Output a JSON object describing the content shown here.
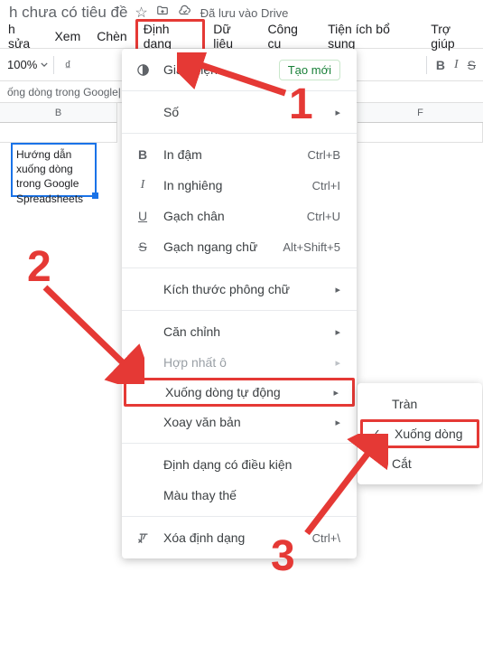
{
  "titlebar": {
    "title": "h chưa có tiêu đề",
    "saved": "Đã lưu vào Drive"
  },
  "menubar": {
    "items": [
      {
        "label": "h sửa"
      },
      {
        "label": "Xem"
      },
      {
        "label": "Chèn"
      },
      {
        "label": "Định dạng"
      },
      {
        "label": "Dữ liệu"
      },
      {
        "label": "Công cụ"
      },
      {
        "label": "Tiện ích bổ sung"
      },
      {
        "label": "Trợ giúp"
      }
    ]
  },
  "toolbar": {
    "zoom": "100%",
    "bold": "B",
    "italic": "I",
    "strike": "S"
  },
  "fxbar": {
    "text": "ống dòng trong Google|"
  },
  "columns": {
    "b": "B",
    "f": "F"
  },
  "cell": {
    "value": "Hướng dẫn\nxuống dòng\ntrong Google\nSpreadsheets"
  },
  "menu": {
    "theme": "Giao diện",
    "create_new": "Tạo mới",
    "number": "Số",
    "bold": "In đậm",
    "bold_sc": "Ctrl+B",
    "italic": "In nghiêng",
    "italic_sc": "Ctrl+I",
    "underline": "Gạch chân",
    "underline_sc": "Ctrl+U",
    "strike": "Gạch ngang chữ",
    "strike_sc": "Alt+Shift+5",
    "fontsize": "Kích thước phông chữ",
    "align": "Căn chỉnh",
    "merge": "Hợp nhất ô",
    "wrap": "Xuống dòng tự động",
    "rotate": "Xoay văn bản",
    "cond": "Định dạng có điều kiện",
    "altcolor": "Màu thay thế",
    "clear": "Xóa định dạng",
    "clear_sc": "Ctrl+\\"
  },
  "submenu": {
    "overflow": "Tràn",
    "wrap": "Xuống dòng",
    "clip": "Cắt"
  },
  "annotations": {
    "n1": "1",
    "n2": "2",
    "n3": "3"
  }
}
